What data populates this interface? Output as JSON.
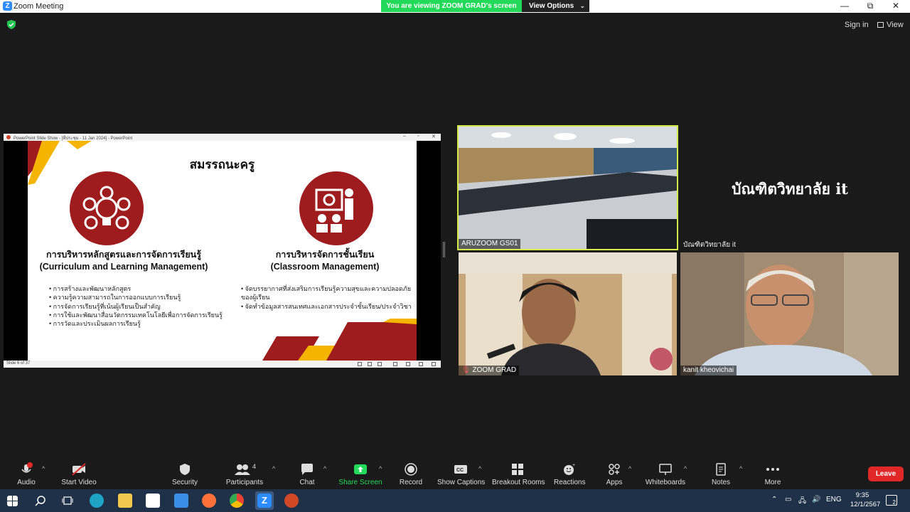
{
  "window": {
    "title": "Zoom Meeting",
    "minimize": "—",
    "maximize": "⧉",
    "close": "✕"
  },
  "banner": {
    "viewing": "You are viewing ZOOM GRAD's screen",
    "view_options": "View Options"
  },
  "top_right": {
    "sign_in": "Sign in",
    "view": "View"
  },
  "ppt": {
    "window_title": "PowerPoint Slide Show - [ที่ประชุม - 11 Jan 2024] - PowerPoint",
    "slide_title": "สมรรถนะครู",
    "left_heading": "การบริหารหลักสูตรและการจัดการเรียนรู้",
    "left_heading_en": "(Curriculum and Learning Management)",
    "left_bullets": [
      "การสร้างและพัฒนาหลักสูตร",
      "ความรู้ความสามารถในการออกแบบการเรียนรู้",
      "การจัดการเรียนรู้ที่เน้นผู้เรียนเป็นสำคัญ",
      "การใช้และพัฒนาสื่อนวัตกรรมเทคโนโลยีเพื่อการจัดการเรียนรู้",
      "การวัดและประเมินผลการเรียนรู้"
    ],
    "right_heading": "การบริหารจัดการชั้นเรียน",
    "right_heading_en": "(Classroom Management)",
    "right_bullets": [
      "จัดบรรยากาศที่ส่งเสริมการเรียนรู้ความสุขและความปลอดภัยของผู้เรียน",
      "จัดทำข้อมูลสารสนเทศและเอกสารประจำชั้นเรียน/ประจำวิชา"
    ],
    "slide_counter": "Slide 6 of 37",
    "accent": "#9e1b1e",
    "accent_yellow": "#f5b400"
  },
  "tiles": {
    "room": {
      "name": "ARUZOOM GS01"
    },
    "it": {
      "display": "บัณฑิตวิทยาลัย  it",
      "name": "บัณฑิตวิทยาลัย  it"
    },
    "grad": {
      "name": "ZOOM GRAD"
    },
    "kanit": {
      "name": "kanit kheovichai"
    }
  },
  "toolbar": {
    "audio": "Audio",
    "start_video": "Start Video",
    "security": "Security",
    "participants": "Participants",
    "participants_count": "4",
    "chat": "Chat",
    "share_screen": "Share Screen",
    "record": "Record",
    "show_captions": "Show Captions",
    "breakout_rooms": "Breakout Rooms",
    "reactions": "Reactions",
    "apps": "Apps",
    "whiteboards": "Whiteboards",
    "notes": "Notes",
    "more": "More",
    "leave": "Leave",
    "share_color": "#23d959",
    "leave_color": "#e02828"
  },
  "taskbar": {
    "lang": "ENG",
    "time": "9:35",
    "date": "12/1/2567",
    "notif_count": "2"
  }
}
